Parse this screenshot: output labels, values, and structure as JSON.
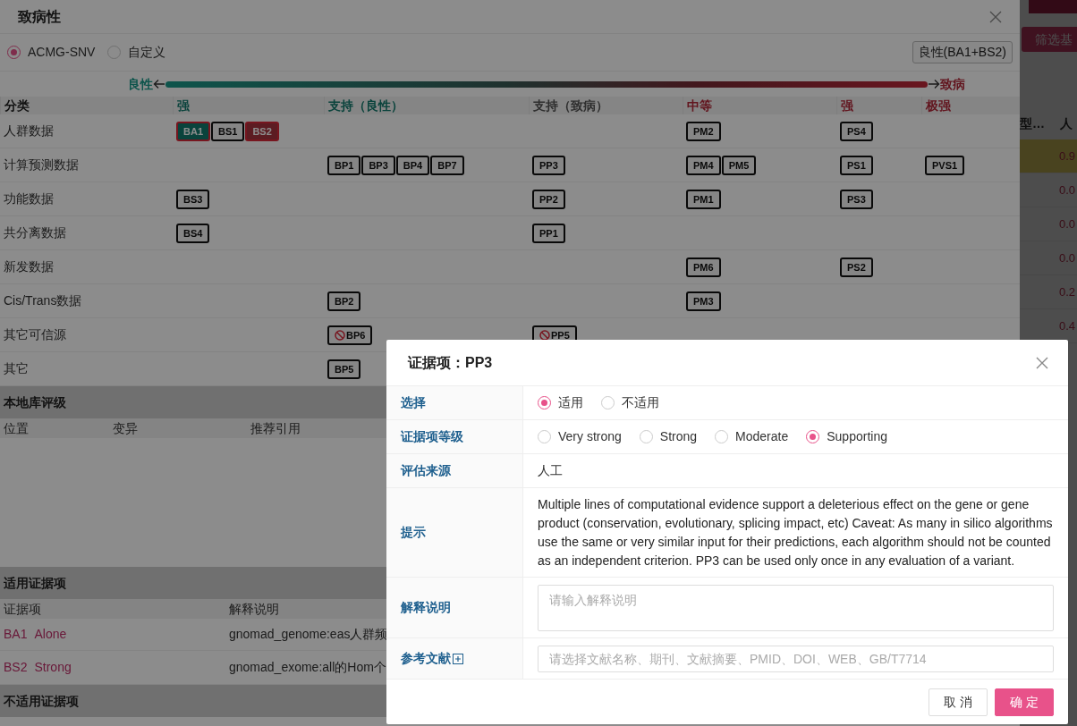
{
  "background_app": {
    "filter_button": "筛选基",
    "columns": [
      "型…",
      "人"
    ],
    "rows": [
      {
        "value": "0.9",
        "highlighted": true
      },
      {
        "value": "0.0",
        "highlighted": false
      },
      {
        "value": "0.0",
        "highlighted": false
      },
      {
        "value": "0.0",
        "highlighted": false
      },
      {
        "value": "0.2",
        "highlighted": false
      },
      {
        "value": "0.4",
        "highlighted": false
      }
    ]
  },
  "pathogenicity_dialog": {
    "title": "致病性",
    "schemes": [
      {
        "label": "ACMG-SNV",
        "selected": true
      },
      {
        "label": "自定义",
        "selected": false
      }
    ],
    "result_button": "良性(BA1+BS2)",
    "scale": {
      "left_label": "良性",
      "right_label": "致病"
    },
    "table": {
      "category_header": "分类",
      "columns": [
        {
          "label": "强",
          "kind": "benign"
        },
        {
          "label": "支持（良性）",
          "kind": "benign"
        },
        {
          "label": "支持（致病）",
          "kind": "neutral"
        },
        {
          "label": "中等",
          "kind": "pathogenic"
        },
        {
          "label": "强",
          "kind": "pathogenic"
        },
        {
          "label": "极强",
          "kind": "pathogenic"
        }
      ],
      "rows": [
        {
          "category": "人群数据",
          "cells": [
            [
              {
                "label": "BA1",
                "applied": true,
                "blocked": false,
                "kind": "teal"
              },
              {
                "label": "BS1",
                "applied": false,
                "blocked": false
              },
              {
                "label": "BS2",
                "applied": true,
                "blocked": false,
                "kind": "red"
              }
            ],
            [],
            [],
            [
              {
                "label": "PM2",
                "applied": false,
                "blocked": false
              }
            ],
            [
              {
                "label": "PS4",
                "applied": false,
                "blocked": false
              }
            ],
            []
          ]
        },
        {
          "category": "计算预测数据",
          "cells": [
            [],
            [
              {
                "label": "BP1",
                "applied": false,
                "blocked": false
              },
              {
                "label": "BP3",
                "applied": false,
                "blocked": false
              },
              {
                "label": "BP4",
                "applied": false,
                "blocked": false
              },
              {
                "label": "BP7",
                "applied": false,
                "blocked": false
              }
            ],
            [
              {
                "label": "PP3",
                "applied": false,
                "blocked": false
              }
            ],
            [
              {
                "label": "PM4",
                "applied": false,
                "blocked": false
              },
              {
                "label": "PM5",
                "applied": false,
                "blocked": false
              }
            ],
            [
              {
                "label": "PS1",
                "applied": false,
                "blocked": false
              }
            ],
            [
              {
                "label": "PVS1",
                "applied": false,
                "blocked": false
              }
            ]
          ]
        },
        {
          "category": "功能数据",
          "cells": [
            [
              {
                "label": "BS3",
                "applied": false,
                "blocked": false
              }
            ],
            [],
            [
              {
                "label": "PP2",
                "applied": false,
                "blocked": false
              }
            ],
            [
              {
                "label": "PM1",
                "applied": false,
                "blocked": false
              }
            ],
            [
              {
                "label": "PS3",
                "applied": false,
                "blocked": false
              }
            ],
            []
          ]
        },
        {
          "category": "共分离数据",
          "cells": [
            [
              {
                "label": "BS4",
                "applied": false,
                "blocked": false
              }
            ],
            [],
            [
              {
                "label": "PP1",
                "applied": false,
                "blocked": false
              }
            ],
            [],
            [],
            []
          ]
        },
        {
          "category": "新发数据",
          "cells": [
            [],
            [],
            [],
            [
              {
                "label": "PM6",
                "applied": false,
                "blocked": false
              }
            ],
            [
              {
                "label": "PS2",
                "applied": false,
                "blocked": false
              }
            ],
            []
          ]
        },
        {
          "category": "Cis/Trans数据",
          "cells": [
            [],
            [
              {
                "label": "BP2",
                "applied": false,
                "blocked": false
              }
            ],
            [],
            [
              {
                "label": "PM3",
                "applied": false,
                "blocked": false
              }
            ],
            [],
            []
          ]
        },
        {
          "category": "其它可信源",
          "cells": [
            [],
            [
              {
                "label": "BP6",
                "applied": false,
                "blocked": true
              }
            ],
            [
              {
                "label": "PP5",
                "applied": false,
                "blocked": true
              }
            ],
            [],
            [],
            []
          ]
        },
        {
          "category": "其它",
          "cells": [
            [],
            [
              {
                "label": "BP5",
                "applied": false,
                "blocked": false
              }
            ],
            [],
            [],
            [],
            []
          ]
        }
      ]
    },
    "local_rating": {
      "title": "本地库评级",
      "columns": [
        "位置",
        "变异",
        "推荐引用"
      ]
    },
    "applicable": {
      "title": "适用证据项",
      "columns": [
        "证据项",
        "解释说明"
      ],
      "rows": [
        {
          "code": "BA1",
          "strength": "Alone",
          "note": "gnomad_genome:eas人群频"
        },
        {
          "code": "BS2",
          "strength": "Strong",
          "note": "gnomad_exome:all的Hom个"
        }
      ]
    },
    "not_applicable": {
      "title": "不适用证据项"
    }
  },
  "evidence_dialog": {
    "title": "证据项：PP3",
    "fields": [
      {
        "kind": "radio",
        "label": "选择",
        "options": [
          {
            "label": "适用",
            "selected": true
          },
          {
            "label": "不适用",
            "selected": false
          }
        ]
      },
      {
        "kind": "radio",
        "label": "证据项等级",
        "options": [
          {
            "label": "Very strong",
            "selected": false
          },
          {
            "label": "Strong",
            "selected": false
          },
          {
            "label": "Moderate",
            "selected": false
          },
          {
            "label": "Supporting",
            "selected": true
          }
        ]
      },
      {
        "kind": "text",
        "label": "评估来源",
        "value": "人工"
      },
      {
        "kind": "hint",
        "label": "提示",
        "value": "Multiple lines of computational evidence support a deleterious effect on the gene or gene product (conservation, evolutionary, splicing impact, etc) Caveat: As many in silico algorithms use the same or very similar input for their predictions, each algorithm should not be counted as an independent criterion. PP3 can be used only once in any evaluation of a variant."
      },
      {
        "kind": "textarea",
        "label": "解释说明",
        "placeholder": "请输入解释说明"
      },
      {
        "kind": "select",
        "label": "参考文献",
        "placeholder": "请选择文献名称、期刊、文献摘要、PMID、DOI、WEB、GB/T7714",
        "add_icon": true
      }
    ],
    "buttons": [
      {
        "label": "取 消",
        "kind": "default"
      },
      {
        "label": "确 定",
        "kind": "primary"
      }
    ]
  }
}
